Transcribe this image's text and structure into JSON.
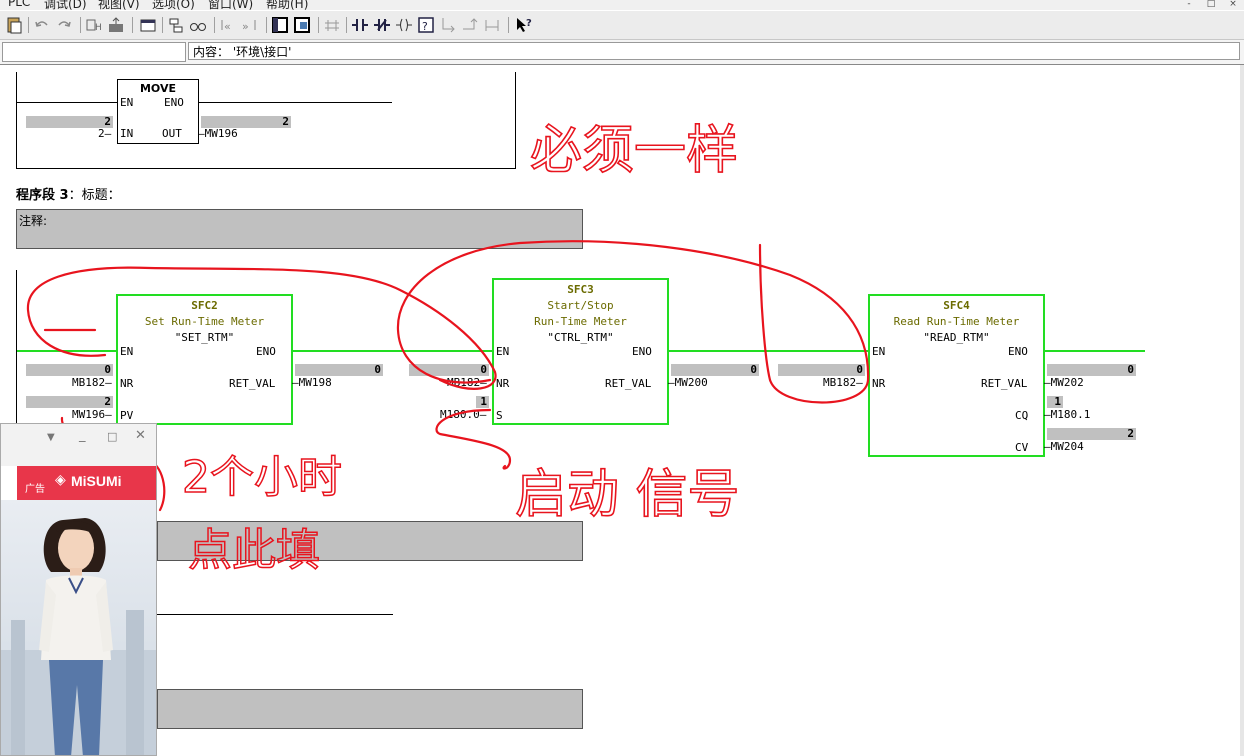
{
  "menu": {
    "items": [
      "PLC",
      "调试(D)",
      "视图(V)",
      "选项(O)",
      "窗口(W)",
      "帮助(H)"
    ]
  },
  "window_buttons": [
    "-",
    "□",
    "×"
  ],
  "statusbar": {
    "content_label": "内容：",
    "content_value": "'环境\\接口'"
  },
  "network_prev": {
    "block": {
      "name": "MOVE",
      "pin_en": "EN",
      "pin_eno": "ENO",
      "pin_in": "IN",
      "pin_out": "OUT"
    },
    "in_value": "2",
    "in_operand": "2",
    "out_operand": "MW196",
    "out_value": "2"
  },
  "network3": {
    "label": "程序段 3",
    "title_sep": "：标题：",
    "comment_label": "注释:"
  },
  "sfc2": {
    "number": "SFC2",
    "desc1": "Set Run-Time Meter",
    "desc2": "",
    "symbol": "\"SET_RTM\"",
    "pin_en": "EN",
    "pin_eno": "ENO",
    "pin_nr": "NR",
    "pin_pv": "PV",
    "pin_retval": "RET_VAL",
    "nr_value": "0",
    "nr_operand": "MB182",
    "pv_value": "2",
    "pv_operand": "MW196",
    "retval_value": "0",
    "retval_operand": "MW198"
  },
  "sfc3": {
    "number": "SFC3",
    "desc1": "Start/Stop",
    "desc2": "Run-Time Meter",
    "symbol": "\"CTRL_RTM\"",
    "pin_en": "EN",
    "pin_eno": "ENO",
    "pin_nr": "NR",
    "pin_s": "S",
    "pin_retval": "RET_VAL",
    "nr_value": "0",
    "nr_operand": "MB182",
    "s_value": "1",
    "s_operand": "M180.0",
    "retval_value": "0",
    "retval_operand": "MW200"
  },
  "sfc4": {
    "number": "SFC4",
    "desc1": "Read Run-Time Meter",
    "symbol": "\"READ_RTM\"",
    "pin_en": "EN",
    "pin_eno": "ENO",
    "pin_nr": "NR",
    "pin_retval": "RET_VAL",
    "pin_cq": "CQ",
    "pin_cv": "CV",
    "nr_value": "0",
    "nr_operand": "MB182",
    "retval_value": "0",
    "retval_operand": "MW202",
    "cq_value": "1",
    "cq_operand": "M180.1",
    "cv_value": "2",
    "cv_operand": "MW204"
  },
  "annotations": {
    "must_same": "必须一样",
    "hours_fill": "2个小时\n点此填",
    "start_signal": "启动 信号",
    "ink_color": "#e8141e"
  },
  "ad": {
    "tag": "广告",
    "brand": "MiSUMi",
    "accent": "#e8364a"
  }
}
